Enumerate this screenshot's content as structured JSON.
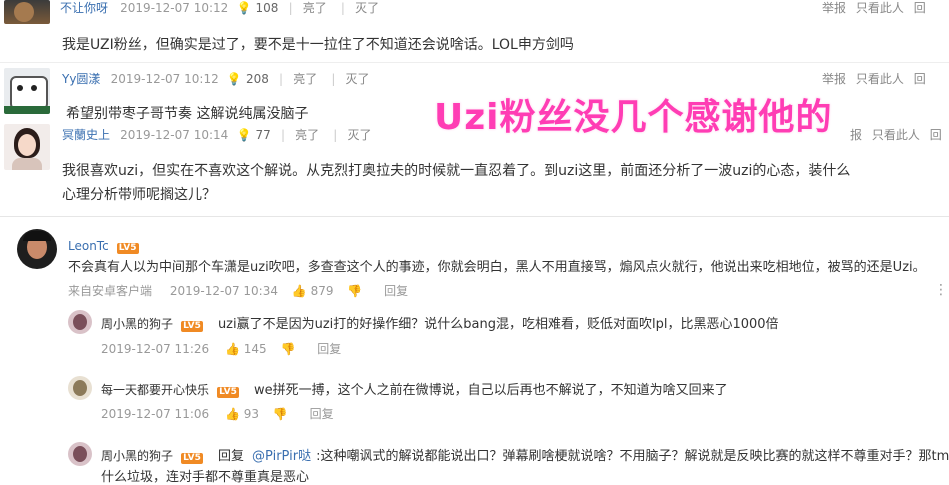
{
  "overlay": {
    "caption": "Uzi粉丝没几个感谢他的"
  },
  "top_comments": [
    {
      "user": "不让你呀",
      "time": "2019-12-07 10:12",
      "score": "108",
      "action_bright": "亮了",
      "action_dislike": "灭了",
      "report": "举报",
      "block": "只看此人",
      "reply": "回",
      "text": "我是UZI粉丝，但确实是过了，要不是十一拉住了不知道还会说啥话。LOL申方剑吗"
    },
    {
      "user": "Yy圆漾",
      "time": "2019-12-07 10:12",
      "score": "208",
      "action_bright": "亮了",
      "action_dislike": "灭了",
      "report": "举报",
      "block": "只看此人",
      "reply": "回",
      "text": "希望别带枣子哥节奏 这解说纯属没脑子"
    },
    {
      "user": "冥蘭史上",
      "time": "2019-12-07 10:14",
      "score": "77",
      "action_bright": "亮了",
      "action_dislike": "灭了",
      "report": "报",
      "block": "只看此人",
      "reply": "回",
      "text_line1": "我很喜欢uzi，但实在不喜欢这个解说。从克烈打奥拉夫的时候就一直忍着了。到uzi这里，前面还分析了一波uzi的心态，装什么",
      "text_line2": "心理分析带师呢搁这儿？"
    }
  ],
  "main_comment": {
    "user": "LeonTc",
    "badge": "LV5",
    "text": "不会真有人以为中间那个车潇是uzi吹吧，多查查这个人的事迹，你就会明白，黑人不用直接骂，煽风点火就行，他说出来吃相地位，被骂的还是Uzi。",
    "source": "来自安卓客户端",
    "time": "2019-12-07 10:34",
    "likes": "879",
    "reply": "回复"
  },
  "replies": [
    {
      "user": "周小黑的狗子",
      "badge": "LV5",
      "text": "uzi赢了不是因为uzi打的好操作细？说什么bang混，吃相难看，贬低对面吹lpl，比黑恶心1000倍",
      "time": "2019-12-07 11:26",
      "likes": "145",
      "reply": "回复"
    },
    {
      "user": "每一天都要开心快乐",
      "badge": "LV5",
      "text": "we拼死一搏，这个人之前在微博说，自己以后再也不解说了，不知道为啥又回来了",
      "time": "2019-12-07 11:06",
      "likes": "93",
      "reply": "回复"
    },
    {
      "user": "周小黑的狗子",
      "badge": "LV5",
      "prefix": "回复",
      "mention": "@PirPir哒",
      "text_line1": ":这种嘲讽式的解说都能说出口？弹幕刷啥梗就说啥？不用脑子？解说就是反映比赛的就这样不尊重对手？那tm",
      "text_line2": "什么垃圾，连对手都不尊重真是恶心"
    }
  ],
  "colors": {
    "accent_pink": "#ff3db4",
    "link_blue": "#3a6fb0",
    "badge_orange": "#f08a24"
  }
}
